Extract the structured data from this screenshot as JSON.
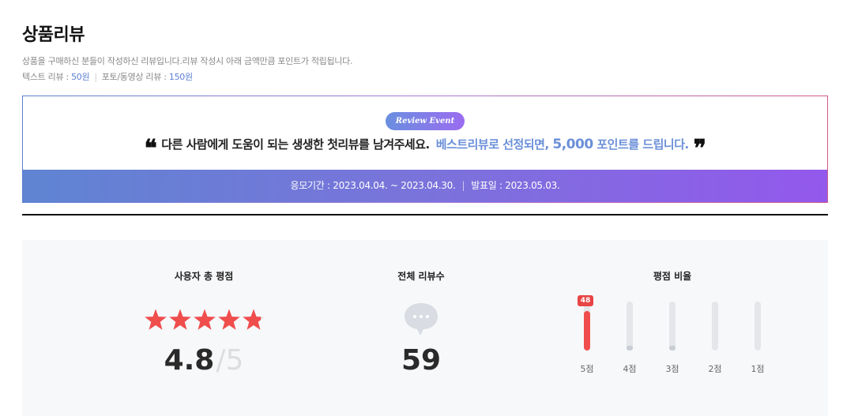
{
  "page": {
    "title": "상품리뷰",
    "description": "상품을 구매하신 분들이 작성하신 리뷰입니다.리뷰 작성시 아래 금액만큼 포인트가 적립됩니다.",
    "text_review_label": "텍스트 리뷰 : ",
    "text_review_value": "50원",
    "separator": "|",
    "photo_review_label": "포토/동영상 리뷰 : ",
    "photo_review_value": "150원"
  },
  "event": {
    "badge": "Review Event",
    "open_quote": "❝",
    "close_quote": "❞",
    "headline": "다른 사람에게 도움이 되는 생생한 첫리뷰를 남겨주세요.",
    "highlight_pre": "베스트리뷰로 선정되면, ",
    "highlight_num": "5,000",
    "highlight_post": " 포인트를 드립니다.",
    "period": "응모기간 : 2023.04.04. ~ 2023.04.30.",
    "announce": "발표일 : 2023.05.03."
  },
  "stats": {
    "rating_title": "사용자 총 평점",
    "rating_score": "4.8",
    "rating_max": "/5",
    "rating_value": 4.8,
    "count_title": "전체 리뷰수",
    "count": "59",
    "bubble_icon": "chat-bubble-icon",
    "ratio_title": "평점 비율",
    "ratio_bars": [
      {
        "label": "5점",
        "count": 48,
        "count_label": "48",
        "fraction": 0.81
      },
      {
        "label": "4점",
        "count": 0,
        "count_label": "",
        "fraction": 0.1
      },
      {
        "label": "3점",
        "count": 0,
        "count_label": "",
        "fraction": 0.1
      },
      {
        "label": "2점",
        "count": 0,
        "count_label": "",
        "fraction": 0.0
      },
      {
        "label": "1점",
        "count": 0,
        "count_label": "",
        "fraction": 0.0
      }
    ]
  },
  "colors": {
    "accent_blue": "#5b7fd6",
    "star_red": "#f04d4d",
    "gradient_start": "#5f84d2",
    "gradient_end": "#9358ec"
  }
}
